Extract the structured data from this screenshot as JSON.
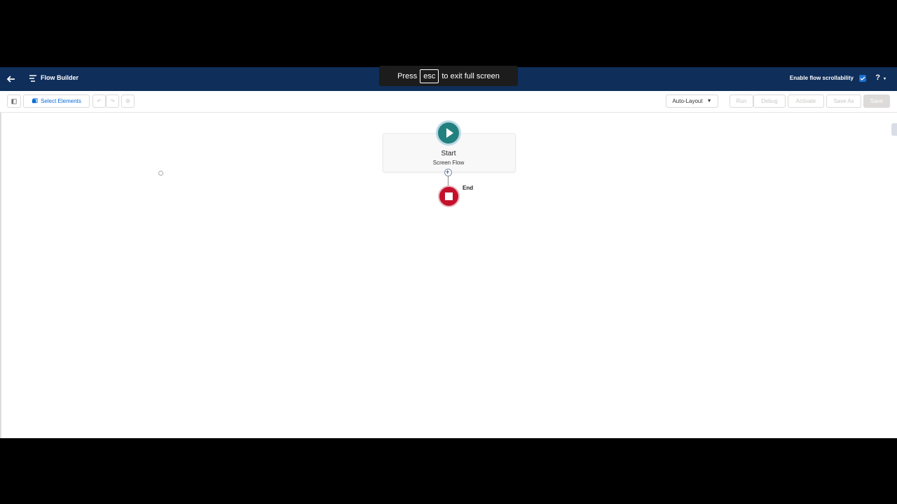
{
  "header": {
    "title": "Flow Builder",
    "scroll_label": "Enable flow scrollability",
    "help": "?"
  },
  "toast": {
    "press": "Press",
    "key": "esc",
    "rest": "to exit full screen"
  },
  "toolbar": {
    "select_elements": "Select Elements",
    "layout": "Auto-Layout",
    "run": "Run",
    "debug": "Debug",
    "activate": "Activate",
    "save_as": "Save As",
    "save": "Save"
  },
  "canvas": {
    "start_label": "Start",
    "start_sub": "Screen Flow",
    "end_label": "End"
  },
  "colors": {
    "header_bg": "#0f2e5a",
    "start_green": "#22807f",
    "end_red": "#c3112c"
  }
}
